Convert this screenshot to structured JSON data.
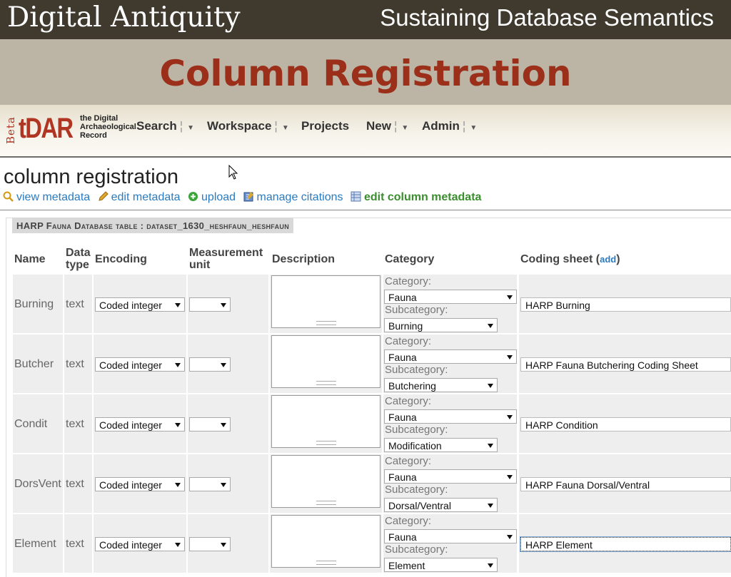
{
  "slide": {
    "brand": "Digital Antiquity",
    "subtitle": "Sustaining Database Semantics",
    "title": "Column Registration"
  },
  "app": {
    "logo_beta": "Beta",
    "logo_name": "tDAR",
    "logo_tagline": "the Digital Archaeological Record",
    "nav": [
      {
        "label": "Search",
        "dropdown": true
      },
      {
        "label": "Workspace",
        "dropdown": true
      },
      {
        "label": "Projects",
        "dropdown": false
      },
      {
        "label": "New",
        "dropdown": true
      },
      {
        "label": "Admin",
        "dropdown": true
      }
    ]
  },
  "page": {
    "heading": "column registration",
    "actions": [
      {
        "label": "view metadata",
        "icon": "magnifier-icon"
      },
      {
        "label": "edit metadata",
        "icon": "pencil-icon"
      },
      {
        "label": "upload",
        "icon": "plus-circle-icon"
      },
      {
        "label": "manage citations",
        "icon": "notepad-icon"
      },
      {
        "label": "edit column metadata",
        "icon": "table-icon",
        "active": true
      }
    ],
    "table_caption": "HARP Fauna Database table : dataset_1630_heshfaun_heshfaun"
  },
  "table": {
    "headers": {
      "name": "Name",
      "data_type_1": "Data",
      "data_type_2": "type",
      "encoding": "Encoding",
      "measurement_1": "Measurement",
      "measurement_2": "unit",
      "description": "Description",
      "category": "Category",
      "coding_sheet": "Coding sheet (",
      "add_link": "add",
      "coding_sheet_end": ")"
    },
    "category_label": "Category:",
    "subcategory_label": "Subcategory:",
    "rows": [
      {
        "name": "Burning",
        "type": "text",
        "encoding": "Coded integer",
        "unit": "",
        "category": "Fauna",
        "subcategory": "Burning",
        "coding_sheet": "HARP Burning"
      },
      {
        "name": "Butcher",
        "type": "text",
        "encoding": "Coded integer",
        "unit": "",
        "category": "Fauna",
        "subcategory": "Butchering",
        "coding_sheet": "HARP Fauna Butchering Coding Sheet"
      },
      {
        "name": "Condit",
        "type": "text",
        "encoding": "Coded integer",
        "unit": "",
        "category": "Fauna",
        "subcategory": "Modification",
        "coding_sheet": "HARP Condition"
      },
      {
        "name": "DorsVent",
        "type": "text",
        "encoding": "Coded integer",
        "unit": "",
        "category": "Fauna",
        "subcategory": "Dorsal/Ventral",
        "coding_sheet": "HARP Fauna Dorsal/Ventral"
      },
      {
        "name": "Element",
        "type": "text",
        "encoding": "Coded integer",
        "unit": "",
        "category": "Fauna",
        "subcategory": "Element",
        "coding_sheet": "HARP Element"
      }
    ]
  },
  "colors": {
    "topbar": "#3f3a2d",
    "title_band": "#bcb5a5",
    "title_text": "#9b2f1a",
    "link": "#2b7bbf",
    "active_link": "#3a8e2d"
  }
}
